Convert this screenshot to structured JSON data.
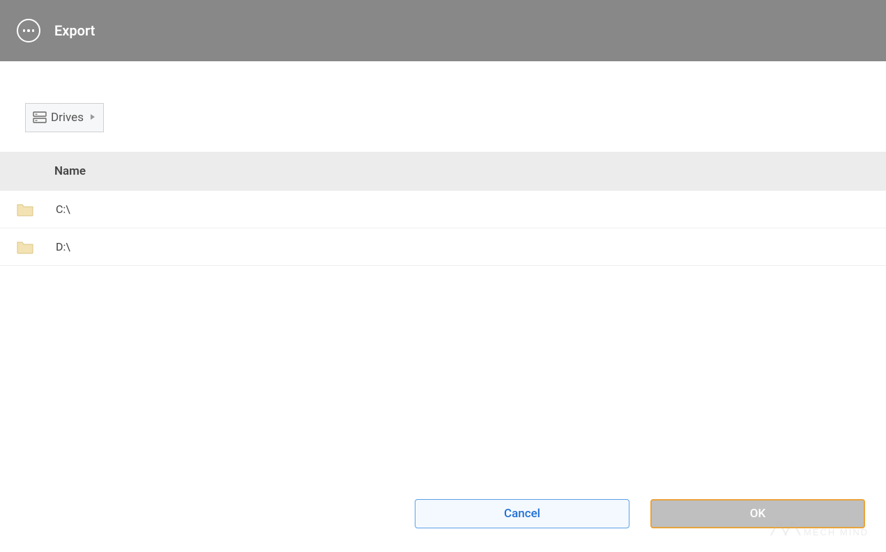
{
  "header": {
    "title": "Export"
  },
  "breadcrumb": {
    "drives_label": "Drives"
  },
  "table": {
    "column_header": "Name",
    "rows": [
      {
        "name": "C:\\"
      },
      {
        "name": "D:\\"
      }
    ]
  },
  "footer": {
    "cancel_label": "Cancel",
    "ok_label": "OK"
  },
  "watermark": {
    "text": "MECH MIND"
  }
}
